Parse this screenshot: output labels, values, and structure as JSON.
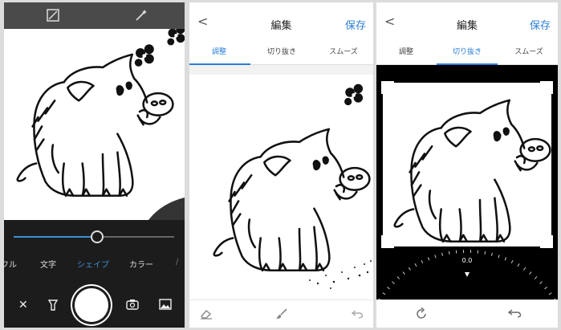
{
  "camera": {
    "slider_value_pct": 52,
    "modes": [
      "フル",
      "文字",
      "シェイプ",
      "カラー",
      "/"
    ],
    "active_mode": "シェイプ",
    "icons": [
      "crop-icon",
      "magic-wand-icon",
      "close-icon",
      "flashlight-icon",
      "shutter-button",
      "camera-flip-icon",
      "gallery-icon"
    ]
  },
  "edit_adjust": {
    "header": {
      "back": "<",
      "title": "編集",
      "save": "保存"
    },
    "tabs": [
      "調整",
      "切り抜き",
      "スムーズ"
    ],
    "active_tab": 0,
    "footer_icons": [
      "eraser-icon",
      "brush-icon",
      "undo-icon"
    ]
  },
  "edit_crop": {
    "header": {
      "back": "<",
      "title": "編集",
      "save": "保存"
    },
    "tabs": [
      "調整",
      "切り抜き",
      "スムーズ"
    ],
    "active_tab": 1,
    "rotation_value": "0.0",
    "footer_icons": [
      "rotate-icon",
      "reset-icon"
    ]
  },
  "colors": {
    "accent": "#2b7fd6",
    "camera_bg": "#1c1c1c"
  }
}
